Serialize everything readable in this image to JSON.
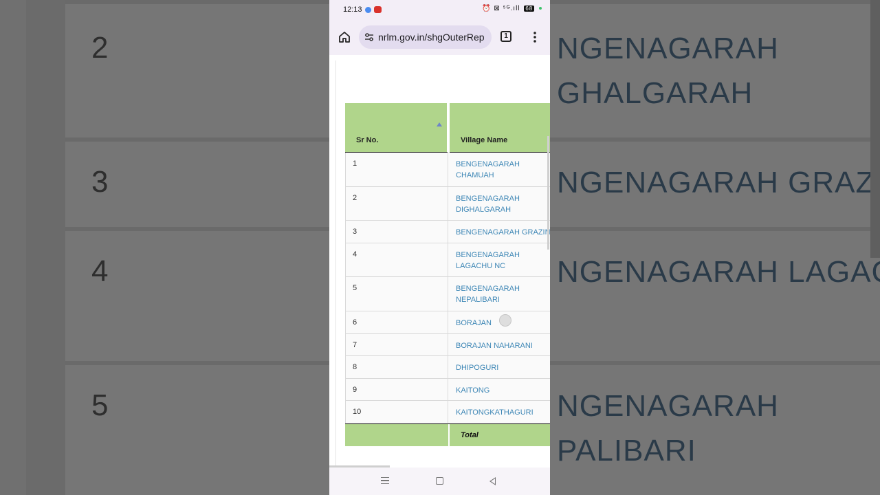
{
  "status_bar": {
    "time": "12:13",
    "icons": "⏰ ⊠ ⁵ᴳ.ıll",
    "battery": "68"
  },
  "browser": {
    "url": "nrlm.gov.in/shgOuterRep",
    "tab_count": "1"
  },
  "table": {
    "headers": {
      "sr_no": "Sr No.",
      "village_name": "Village Name"
    },
    "rows": [
      {
        "sr": "1",
        "village": "BENGENAGARAH CHAMUAH"
      },
      {
        "sr": "2",
        "village": "BENGENAGARAH DIGHALGARAH"
      },
      {
        "sr": "3",
        "village": "BENGENAGARAH GRAZING"
      },
      {
        "sr": "4",
        "village": "BENGENAGARAH LAGACHU NC"
      },
      {
        "sr": "5",
        "village": "BENGENAGARAH NEPALIBARI"
      },
      {
        "sr": "6",
        "village": "BORAJAN"
      },
      {
        "sr": "7",
        "village": "BORAJAN NAHARANI"
      },
      {
        "sr": "8",
        "village": "DHIPOGURI"
      },
      {
        "sr": "9",
        "village": "KAITONG"
      },
      {
        "sr": "10",
        "village": "KAITONGKATHAGURI"
      }
    ],
    "total_label": "Total"
  },
  "background": {
    "numbers": [
      "2",
      "3",
      "4",
      "5"
    ],
    "texts": [
      "NGENAGARAH",
      "GHALGARAH",
      "NGENAGARAH GRAZIN",
      "NGENAGARAH LAGACH",
      "NGENAGARAH",
      "PALIBARI"
    ]
  },
  "colors": {
    "header_green": "#b0d58b",
    "link_blue": "#3d86b5",
    "browser_bar": "#f3eef7"
  }
}
